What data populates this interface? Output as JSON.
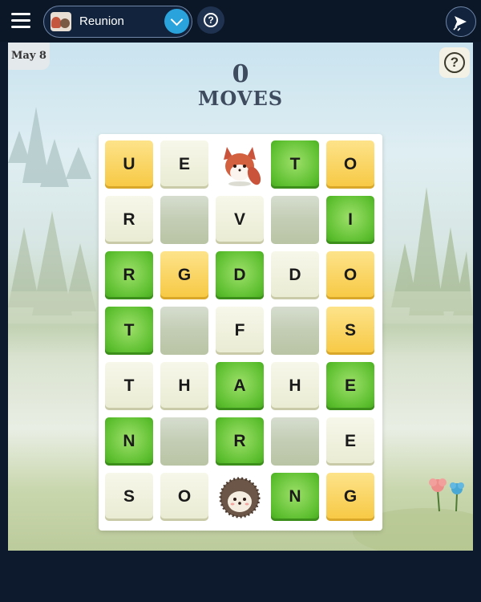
{
  "header": {
    "puzzle_name": "Reunion",
    "menu_icon": "hamburger-icon",
    "dropdown_icon": "chevron-down-icon",
    "help_icon": "question-circle-icon",
    "share_icon": "share-icon"
  },
  "game": {
    "date": "May 8",
    "moves_count": "0",
    "moves_label": "MOVES",
    "help_icon": "question-circle-icon"
  },
  "colors": {
    "yellow": "#f7c842",
    "green": "#59bd2c",
    "plain": "#eff0dc",
    "empty": "#c3cdb4",
    "header_bg": "#0b1626",
    "accent_blue": "#2aa3dd"
  },
  "grid": [
    [
      {
        "letter": "U",
        "state": "yellow"
      },
      {
        "letter": "E",
        "state": "plain"
      },
      {
        "letter": "",
        "state": "fox"
      },
      {
        "letter": "T",
        "state": "green"
      },
      {
        "letter": "O",
        "state": "yellow"
      }
    ],
    [
      {
        "letter": "R",
        "state": "plain"
      },
      {
        "letter": "",
        "state": "empty"
      },
      {
        "letter": "V",
        "state": "plain"
      },
      {
        "letter": "",
        "state": "empty"
      },
      {
        "letter": "I",
        "state": "green"
      }
    ],
    [
      {
        "letter": "R",
        "state": "green"
      },
      {
        "letter": "G",
        "state": "yellow"
      },
      {
        "letter": "D",
        "state": "green"
      },
      {
        "letter": "D",
        "state": "plain"
      },
      {
        "letter": "O",
        "state": "yellow"
      }
    ],
    [
      {
        "letter": "T",
        "state": "green"
      },
      {
        "letter": "",
        "state": "empty"
      },
      {
        "letter": "F",
        "state": "plain"
      },
      {
        "letter": "",
        "state": "empty"
      },
      {
        "letter": "S",
        "state": "yellow"
      }
    ],
    [
      {
        "letter": "T",
        "state": "plain"
      },
      {
        "letter": "H",
        "state": "plain"
      },
      {
        "letter": "A",
        "state": "green"
      },
      {
        "letter": "H",
        "state": "plain"
      },
      {
        "letter": "E",
        "state": "green"
      }
    ],
    [
      {
        "letter": "N",
        "state": "green"
      },
      {
        "letter": "",
        "state": "empty"
      },
      {
        "letter": "R",
        "state": "green"
      },
      {
        "letter": "",
        "state": "empty"
      },
      {
        "letter": "E",
        "state": "plain"
      }
    ],
    [
      {
        "letter": "S",
        "state": "plain"
      },
      {
        "letter": "O",
        "state": "plain"
      },
      {
        "letter": "",
        "state": "hedgehog"
      },
      {
        "letter": "N",
        "state": "green"
      },
      {
        "letter": "G",
        "state": "yellow"
      }
    ]
  ],
  "characters": {
    "fox": "fox-icon",
    "hedgehog": "hedgehog-icon"
  }
}
